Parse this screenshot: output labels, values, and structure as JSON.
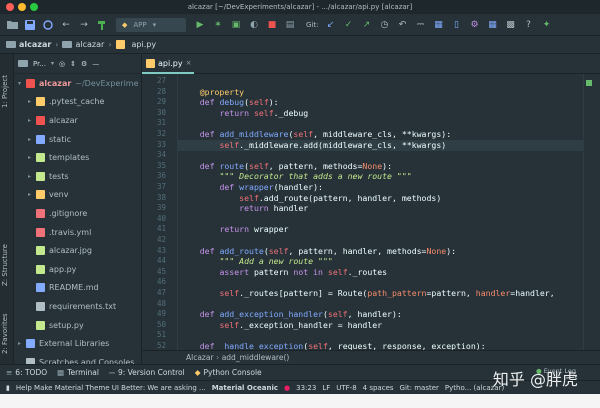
{
  "window": {
    "title": "alcazar [~/DevExperiments/alcazar] - .../alcazar/api.py [alcazar]"
  },
  "toolbar": {
    "run_config": "APP",
    "git_label": "Git:"
  },
  "navbar": {
    "crumbs": [
      "alcazar",
      "alcazar",
      "api.py"
    ]
  },
  "side_labels": {
    "project": "1: Project",
    "structure": "Z: Structure",
    "favorites": "2: Favorites"
  },
  "project_panel": {
    "title": "Pr...",
    "tree": [
      {
        "label": "alcazar",
        "extra": "~/DevExperime",
        "color": "#ef5350"
      },
      {
        "label": ".pytest_cache",
        "color": "#ffcb6b"
      },
      {
        "label": "alcazar",
        "color": "#ef5350"
      },
      {
        "label": "static",
        "color": "#82aaff"
      },
      {
        "label": "templates",
        "color": "#c3e88d"
      },
      {
        "label": "tests",
        "color": "#c3e88d"
      },
      {
        "label": "venv",
        "color": "#ffcb6b"
      },
      {
        "label": ".gitignore",
        "color": "#f07178"
      },
      {
        "label": ".travis.yml",
        "color": "#f07178"
      },
      {
        "label": "alcazar.jpg",
        "color": "#c3e88d"
      },
      {
        "label": "app.py",
        "color": "#c3e88d"
      },
      {
        "label": "README.md",
        "color": "#82aaff"
      },
      {
        "label": "requirements.txt",
        "color": "#b0bec5"
      },
      {
        "label": "setup.py",
        "color": "#c3e88d"
      },
      {
        "label": "External Libraries",
        "color": "#82aaff"
      },
      {
        "label": "Scratches and Consoles",
        "color": "#b0bec5"
      }
    ]
  },
  "tab": {
    "label": "api.py"
  },
  "code": {
    "line_numbers": [
      "27",
      "28",
      "29",
      "30",
      "31",
      "32",
      "33",
      "34",
      "35",
      "36",
      "37",
      "38",
      "39",
      "40",
      "41",
      "42",
      "43",
      "44",
      "45",
      "46",
      "47",
      "48",
      "49",
      "50",
      "51",
      "52",
      "53",
      "54"
    ],
    "lines": [
      [],
      [
        {
          "t": "    "
        },
        {
          "t": "@property",
          "c": "#ffcb6b"
        }
      ],
      [
        {
          "t": "    "
        },
        {
          "t": "def ",
          "c": "#c792ea"
        },
        {
          "t": "debug",
          "c": "#82aaff"
        },
        {
          "t": "("
        },
        {
          "t": "self",
          "c": "#f07178"
        },
        {
          "t": "):"
        }
      ],
      [
        {
          "t": "        "
        },
        {
          "t": "return ",
          "c": "#c792ea"
        },
        {
          "t": "self",
          "c": "#f07178"
        },
        {
          "t": "._debug"
        }
      ],
      [],
      [
        {
          "t": "    "
        },
        {
          "t": "def ",
          "c": "#c792ea"
        },
        {
          "t": "add_middleware",
          "c": "#82aaff"
        },
        {
          "t": "("
        },
        {
          "t": "self",
          "c": "#f07178"
        },
        {
          "t": ", middleware_cls, **kwargs):"
        }
      ],
      [
        {
          "t": "        "
        },
        {
          "t": "self",
          "c": "#f07178"
        },
        {
          "t": "._middleware.add(middleware_cls, **kwargs)"
        }
      ],
      [],
      [
        {
          "t": "    "
        },
        {
          "t": "def ",
          "c": "#c792ea"
        },
        {
          "t": "route",
          "c": "#82aaff"
        },
        {
          "t": "("
        },
        {
          "t": "self",
          "c": "#f07178"
        },
        {
          "t": ", pattern, methods="
        },
        {
          "t": "None",
          "c": "#f78c6c"
        },
        {
          "t": "):"
        }
      ],
      [
        {
          "t": "        "
        },
        {
          "t": "\"\"\" Decorator that adds a new route \"\"\"",
          "c": "#c3e88d",
          "i": true
        }
      ],
      [
        {
          "t": "        "
        },
        {
          "t": "def ",
          "c": "#c792ea"
        },
        {
          "t": "wrapper",
          "c": "#82aaff"
        },
        {
          "t": "(handler):"
        }
      ],
      [
        {
          "t": "            "
        },
        {
          "t": "self",
          "c": "#f07178"
        },
        {
          "t": ".add_route(pattern, handler, methods)"
        }
      ],
      [
        {
          "t": "            "
        },
        {
          "t": "return ",
          "c": "#c792ea"
        },
        {
          "t": "handler"
        }
      ],
      [],
      [
        {
          "t": "        "
        },
        {
          "t": "return ",
          "c": "#c792ea"
        },
        {
          "t": "wrapper"
        }
      ],
      [],
      [
        {
          "t": "    "
        },
        {
          "t": "def ",
          "c": "#c792ea"
        },
        {
          "t": "add_route",
          "c": "#82aaff"
        },
        {
          "t": "("
        },
        {
          "t": "self",
          "c": "#f07178"
        },
        {
          "t": ", pattern, handler, methods="
        },
        {
          "t": "None",
          "c": "#f78c6c"
        },
        {
          "t": "):"
        }
      ],
      [
        {
          "t": "        "
        },
        {
          "t": "\"\"\" Add a new route \"\"\"",
          "c": "#c3e88d",
          "i": true
        }
      ],
      [
        {
          "t": "        "
        },
        {
          "t": "assert ",
          "c": "#c792ea"
        },
        {
          "t": "pattern "
        },
        {
          "t": "not in ",
          "c": "#c792ea"
        },
        {
          "t": "self",
          "c": "#f07178"
        },
        {
          "t": "._routes"
        }
      ],
      [],
      [
        {
          "t": "        "
        },
        {
          "t": "self",
          "c": "#f07178"
        },
        {
          "t": "._routes[pattern] = Route("
        },
        {
          "t": "path_pattern",
          "c": "#f78c6c"
        },
        {
          "t": "=pattern, "
        },
        {
          "t": "handler",
          "c": "#f78c6c"
        },
        {
          "t": "=handler,"
        }
      ],
      [],
      [
        {
          "t": "    "
        },
        {
          "t": "def ",
          "c": "#c792ea"
        },
        {
          "t": "add_exception_handler",
          "c": "#82aaff"
        },
        {
          "t": "("
        },
        {
          "t": "self",
          "c": "#f07178"
        },
        {
          "t": ", handler):"
        }
      ],
      [
        {
          "t": "        "
        },
        {
          "t": "self",
          "c": "#f07178"
        },
        {
          "t": "._exception_handler = handler"
        }
      ],
      [],
      [
        {
          "t": "    "
        },
        {
          "t": "def ",
          "c": "#c792ea"
        },
        {
          "t": "_handle_exception",
          "c": "#82aaff"
        },
        {
          "t": "("
        },
        {
          "t": "self",
          "c": "#f07178"
        },
        {
          "t": ", request, response, exception):"
        }
      ]
    ],
    "highlight_line": "33"
  },
  "breadcrumb": {
    "class_name": "Alcazar",
    "method": "add_middleware()"
  },
  "bottom_tabs": [
    "6: TODO",
    "Terminal",
    "9: Version Control",
    "Python Console"
  ],
  "event_log": "Event Log",
  "status": {
    "message": "Help Make Material Theme UI Better: We are asking ...",
    "theme": "Material Oceanic",
    "position": "33:23",
    "line_sep": "LF",
    "encoding": "UTF-8",
    "indent": "4 spaces",
    "git": "Git: master",
    "interpreter": "Pytho... (alcazar)"
  },
  "watermark": "知乎 @胖虎",
  "colors": {
    "accent": "#80cbc4",
    "background": "#263238"
  }
}
